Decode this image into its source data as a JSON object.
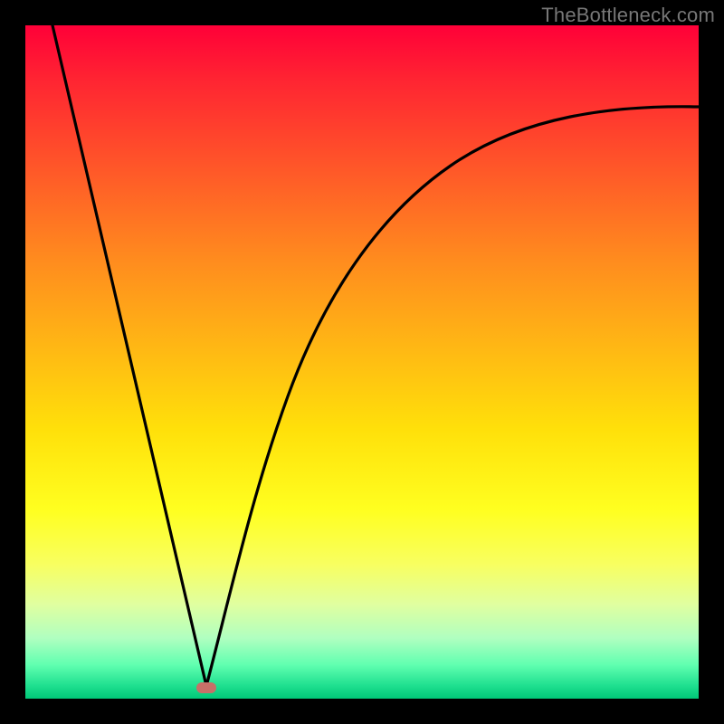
{
  "watermark": "TheBottleneck.com",
  "colors": {
    "frame": "#000000",
    "curve": "#000000",
    "marker": "#c77068"
  },
  "chart_data": {
    "type": "line",
    "title": "",
    "xlabel": "",
    "ylabel": "",
    "xlim": [
      0,
      100
    ],
    "ylim": [
      0,
      100
    ],
    "grid": false,
    "legend": false,
    "background_gradient": {
      "direction": "vertical",
      "top_color": "#ff0038",
      "bottom_color": "#00c878",
      "meaning": "high (red) to low (green) bottleneck severity"
    },
    "series": [
      {
        "name": "left-branch",
        "x": [
          0,
          3,
          6,
          9,
          12,
          15,
          18,
          21,
          24,
          26.8
        ],
        "values": [
          100,
          89,
          78,
          67,
          56,
          45,
          34,
          23,
          12,
          2
        ]
      },
      {
        "name": "right-branch",
        "x": [
          26.8,
          29,
          32,
          35,
          38,
          42,
          46,
          50,
          55,
          60,
          66,
          72,
          79,
          86,
          93,
          100
        ],
        "values": [
          2,
          10,
          22,
          32,
          40,
          49,
          56,
          62,
          67,
          72,
          76,
          79,
          82,
          84.5,
          86.5,
          88
        ]
      }
    ],
    "marker": {
      "x": 26.8,
      "y": 2
    }
  }
}
